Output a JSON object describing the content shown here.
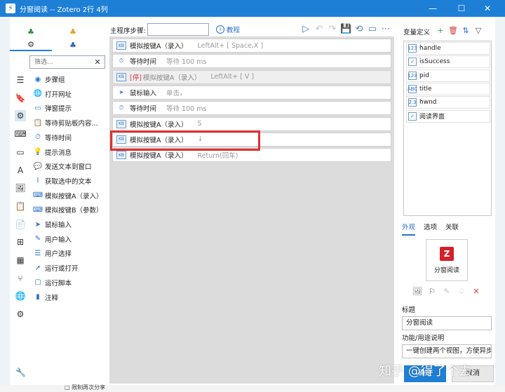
{
  "window": {
    "title": "分窗阅读 -- Zotero 2行 4列",
    "app_icon": "lightning-icon",
    "minimize_glyph": "—",
    "maximize_glyph": "☐",
    "close_glyph": "✕"
  },
  "left_tabs": [
    {
      "glyph": "♣",
      "color": "#2e8b3e",
      "icon": "actions-icon"
    },
    {
      "glyph": "♣",
      "color": "#e39a1a",
      "icon": "triggers-icon"
    },
    {
      "glyph": "⚙",
      "color": "#333333",
      "icon": "settings-cog-icon"
    },
    {
      "glyph": "♣",
      "color": "#2a5bb5",
      "icon": "plugins-icon"
    }
  ],
  "filter": {
    "placeholder": "筛选...",
    "clear_glyph": "✕"
  },
  "icon_bar": [
    {
      "glyph": "☰",
      "icon": "menu-icon"
    },
    {
      "glyph": "🔖",
      "icon": "bookmark-icon"
    },
    {
      "glyph": "⚙",
      "icon": "gear-icon"
    },
    {
      "glyph": "⌨",
      "icon": "keyboard-icon"
    },
    {
      "glyph": "▭",
      "icon": "window-icon"
    },
    {
      "glyph": "A",
      "icon": "text-icon"
    },
    {
      "glyph": "🖼",
      "icon": "image-icon"
    },
    {
      "glyph": "📋",
      "icon": "clipboard-icon"
    },
    {
      "glyph": "📄",
      "icon": "document-icon"
    },
    {
      "glyph": "⊞",
      "icon": "windows-icon"
    },
    {
      "glyph": "▦",
      "icon": "grid-icon"
    },
    {
      "glyph": "⑂",
      "icon": "branch-icon"
    },
    {
      "glyph": "🌐",
      "icon": "globe-icon"
    },
    {
      "glyph": "⚙",
      "icon": "cogs-icon"
    }
  ],
  "step_types": [
    {
      "label": "步骤组",
      "glyph": "◉",
      "icon": "step-group-icon"
    },
    {
      "label": "打开网址",
      "glyph": "🌐",
      "icon": "open-url-icon"
    },
    {
      "label": "弹窗提示",
      "glyph": "▭",
      "icon": "popup-icon"
    },
    {
      "label": "等待剪贴板内容...",
      "glyph": "📋",
      "icon": "clipboard-wait-icon"
    },
    {
      "label": "等待时间",
      "glyph": "⏱",
      "icon": "timer-icon"
    },
    {
      "label": "提示消息",
      "glyph": "💡",
      "icon": "message-icon"
    },
    {
      "label": "发送文本到窗口",
      "glyph": "💬",
      "icon": "send-text-icon"
    },
    {
      "label": "获取选中的文本",
      "glyph": "I",
      "icon": "text-cursor-icon"
    },
    {
      "label": "模拟按键A（录入）",
      "glyph": "⌨",
      "icon": "keyboard-icon"
    },
    {
      "label": "模拟按键B（参数）",
      "glyph": "⌨",
      "icon": "keyboard-icon"
    },
    {
      "label": "鼠标输入",
      "glyph": "➤",
      "icon": "mouse-pointer-icon"
    },
    {
      "label": "用户输入",
      "glyph": "✎",
      "icon": "user-input-icon"
    },
    {
      "label": "用户选择",
      "glyph": "☰",
      "icon": "user-select-icon"
    },
    {
      "label": "运行或打开",
      "glyph": "➚",
      "icon": "run-icon"
    },
    {
      "label": "运行脚本",
      "glyph": "▢",
      "icon": "script-icon"
    },
    {
      "label": "注释",
      "glyph": "▮",
      "icon": "comment-icon"
    }
  ],
  "main": {
    "steps_label": "主程序步骤:",
    "steps_input_value": "",
    "tutorial_label": "教程",
    "toolbar": [
      {
        "glyph": "▷",
        "icon": "run-icon",
        "enabled": true
      },
      {
        "glyph": "↶",
        "icon": "undo-icon",
        "enabled": false
      },
      {
        "glyph": "↷",
        "icon": "redo-icon",
        "enabled": false
      },
      {
        "glyph": "💾",
        "icon": "save-icon",
        "enabled": true
      },
      {
        "glyph": "⟲",
        "icon": "history-icon",
        "enabled": true
      },
      {
        "glyph": "▭",
        "icon": "comment-icon",
        "enabled": true
      },
      {
        "glyph": "⋯",
        "icon": "more-icon",
        "enabled": true
      }
    ],
    "steps": [
      {
        "name": "模拟按键A（录入）",
        "param": "LeftAlt+ [ Space,X ]",
        "type": "keyboard",
        "disabled": false,
        "tag": ""
      },
      {
        "name": "等待时间",
        "param": "等待 100 ms",
        "type": "timer",
        "disabled": false,
        "tag": ""
      },
      {
        "name": "模拟按键A（录入）",
        "param": "LeftAlt+ [ V ]",
        "type": "keyboard",
        "disabled": true,
        "tag": "[停]"
      },
      {
        "name": "鼠标输入",
        "param": "单击，",
        "type": "mouse",
        "disabled": false,
        "tag": ""
      },
      {
        "name": "等待时间",
        "param": "等待 100 ms",
        "type": "timer",
        "disabled": false,
        "tag": ""
      },
      {
        "name": "模拟按键A（录入）",
        "param": "S",
        "type": "keyboard",
        "disabled": false,
        "tag": ""
      },
      {
        "name": "模拟按键A（录入）",
        "param": "↓",
        "type": "keyboard",
        "disabled": false,
        "tag": ""
      },
      {
        "name": "模拟按键A（录入）",
        "param": "Return(回车)",
        "type": "keyboard",
        "disabled": false,
        "tag": ""
      }
    ]
  },
  "right": {
    "var_title": "变量定义",
    "var_tools": [
      {
        "glyph": "+",
        "icon": "add-variable-icon",
        "color": "#2e9e3e"
      },
      {
        "glyph": "🗑",
        "icon": "delete-variable-icon",
        "color": "#d23b3b"
      },
      {
        "glyph": "⇅",
        "icon": "sort-icon",
        "color": "#2a72c9"
      },
      {
        "glyph": "▽",
        "icon": "filter-icon",
        "color": "#555555"
      }
    ],
    "variables": [
      {
        "name": "handle",
        "type_glyph": "123",
        "icon": "number-icon"
      },
      {
        "name": "isSuccess",
        "type_glyph": "✓",
        "icon": "checkbox-icon"
      },
      {
        "name": "pid",
        "type_glyph": "123",
        "icon": "number-icon"
      },
      {
        "name": "title",
        "type_glyph": "ABC",
        "icon": "string-icon"
      },
      {
        "name": "hwnd",
        "type_glyph": "2.3",
        "icon": "decimal-icon"
      },
      {
        "name": "阅读界面",
        "type_glyph": "✓",
        "icon": "checkbox-icon"
      }
    ],
    "tabs": [
      "外观",
      "选项",
      "关联"
    ],
    "preview_label": "分窗阅读",
    "preview_logo": "Z",
    "preview_tools": [
      {
        "glyph": "🖼",
        "icon": "image-icon",
        "color": "#666666"
      },
      {
        "glyph": "⚐",
        "icon": "flag-icon",
        "color": "#666666"
      },
      {
        "glyph": "✎",
        "icon": "pen-icon",
        "color": "#b9c3cc"
      },
      {
        "glyph": "♤",
        "icon": "shirt-icon",
        "color": "#b9c3cc"
      },
      {
        "glyph": "✕",
        "icon": "remove-icon",
        "color": "#d23b3b"
      }
    ],
    "title_label": "标题",
    "title_value": "分窗阅读",
    "desc_label": "功能/用途说明",
    "desc_value": "一键创建两个视图，方便异步",
    "ok_label": "确定",
    "cancel_label": "取消"
  },
  "watermark": "知乎 @得了个去",
  "bottom_hint": "□ 限制再次分享",
  "accent": "#1e7fd6"
}
